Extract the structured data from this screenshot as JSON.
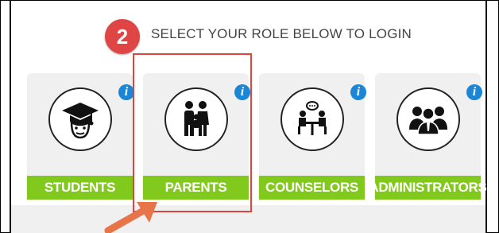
{
  "step": {
    "number": "2"
  },
  "heading": "SELECT YOUR ROLE BELOW TO LOGIN",
  "roles": [
    {
      "label": "STUDENTS",
      "icon": "graduate-cap-icon",
      "info": "i"
    },
    {
      "label": "PARENTS",
      "icon": "parent-child-icon",
      "info": "i"
    },
    {
      "label": "COUNSELORS",
      "icon": "counselor-meeting-icon",
      "info": "i"
    },
    {
      "label": "ADMINISTRATORS",
      "icon": "administrators-group-icon",
      "info": "i"
    }
  ],
  "colors": {
    "badge": "#e04545",
    "label_green": "#82c91e",
    "info_blue": "#1b86d6",
    "highlight": "#e0453d",
    "card_bg": "#f0f0f0"
  }
}
